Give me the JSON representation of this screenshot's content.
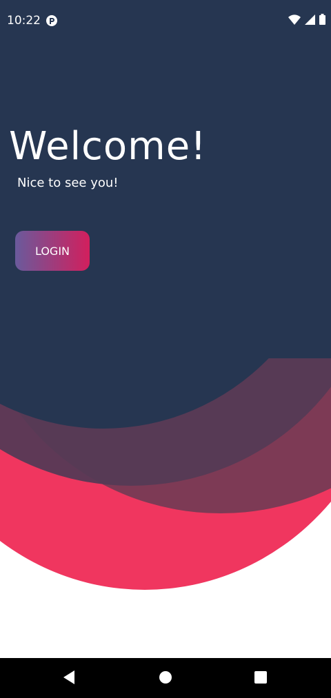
{
  "status_bar": {
    "time": "10:22",
    "icons": [
      "app-notification-icon",
      "wifi-icon",
      "cellular-signal-icon",
      "battery-icon"
    ]
  },
  "welcome": {
    "title": "Welcome!",
    "subtitle": "Nice to see you!"
  },
  "actions": {
    "login_label": "LOGIN"
  },
  "colors": {
    "navy": "#263651",
    "pink": "#f0365f",
    "maroon": "#7d3a55",
    "button_gradient_start": "#6a5a9c",
    "button_gradient_end": "#d21f5d"
  },
  "nav_bar": {
    "icons": [
      "back-icon",
      "home-icon",
      "recents-icon"
    ]
  }
}
